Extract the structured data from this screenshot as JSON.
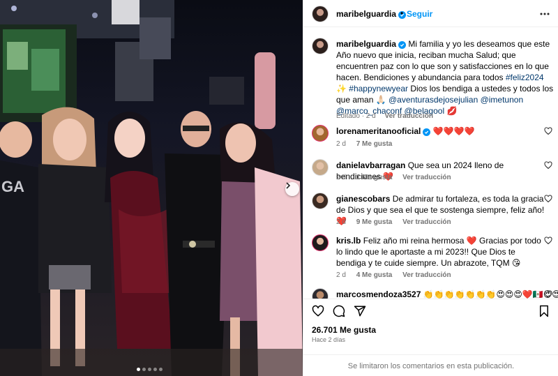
{
  "post": {
    "username": "maribelguardia",
    "follow_label": "Seguir",
    "separator": "•",
    "caption_plain_1": "Mi familia y yo les deseamos que este Año nuevo que inicia, reciban mucha Salud; que encuentren paz con lo que son y satisfacciones en lo que hacen. Bendiciones y abundancia para todos ",
    "caption_tag_1": "#feliz2024",
    "caption_emoji_1": " ✨ ",
    "caption_tag_2": "#happynewyear",
    "caption_plain_2": " Dios los bendiga a ustedes y todos los que aman 🙏🏻 ",
    "caption_mentions": "@aventurasdejosejulian @imetunon @marco_chaconf @belagool",
    "caption_emoji_2": " 💋",
    "caption_edited": "Editado · 2 d",
    "caption_translate": "Ver traducción"
  },
  "comments": [
    {
      "username": "lorenameritanooficial",
      "text": " ❤️❤️❤️❤️",
      "time": "2 d",
      "likes": "7 Me gusta",
      "translate": ""
    },
    {
      "username": "danielavbarragan",
      "text": " Que sea un 2024 lleno de bendiciones ❤️",
      "time": "2 d",
      "likes": "1 Me gusta",
      "translate": "Ver traducción"
    },
    {
      "username": "gianescobars",
      "text": " De admirar tu fortaleza, es toda la gracia de Dios y que sea el que te sostenga siempre, feliz año! ❤️",
      "time": "2 d",
      "likes": "9 Me gusta",
      "translate": "Ver traducción"
    },
    {
      "username": "kris.lb",
      "text": " Feliz año mi reina hermosa ❤️ Gracias por todo lo lindo que le aportaste a mi 2023!! Que Dios te bendiga y te cuide siempre. Un abrazote, TQM 😘",
      "time": "2 d",
      "likes": "4 Me gusta",
      "translate": "Ver traducción"
    },
    {
      "username": "marcosmendoza3527",
      "text": " 👏👏👏👏👏👏👏😍😍😍❤️🇲🇽😍😍😍",
      "time": "",
      "likes": "",
      "translate": ""
    }
  ],
  "actions": {
    "like_count": "26.701 Me gusta",
    "time_ago": "Hace 2 días",
    "comments_limited": "Se limitaron los comentarios en esta publicación."
  },
  "icons": {
    "verified": "verified-badge-icon",
    "more": "more-options-icon",
    "like": "heart-icon",
    "comment": "comment-icon",
    "share": "share-icon",
    "save": "bookmark-icon",
    "next": "chevron-right-icon"
  },
  "colors": {
    "link": "#00376b",
    "follow": "#0095f6",
    "meta": "#737373",
    "border": "#efefef"
  },
  "carousel": {
    "count": 5,
    "active_index": 0
  }
}
